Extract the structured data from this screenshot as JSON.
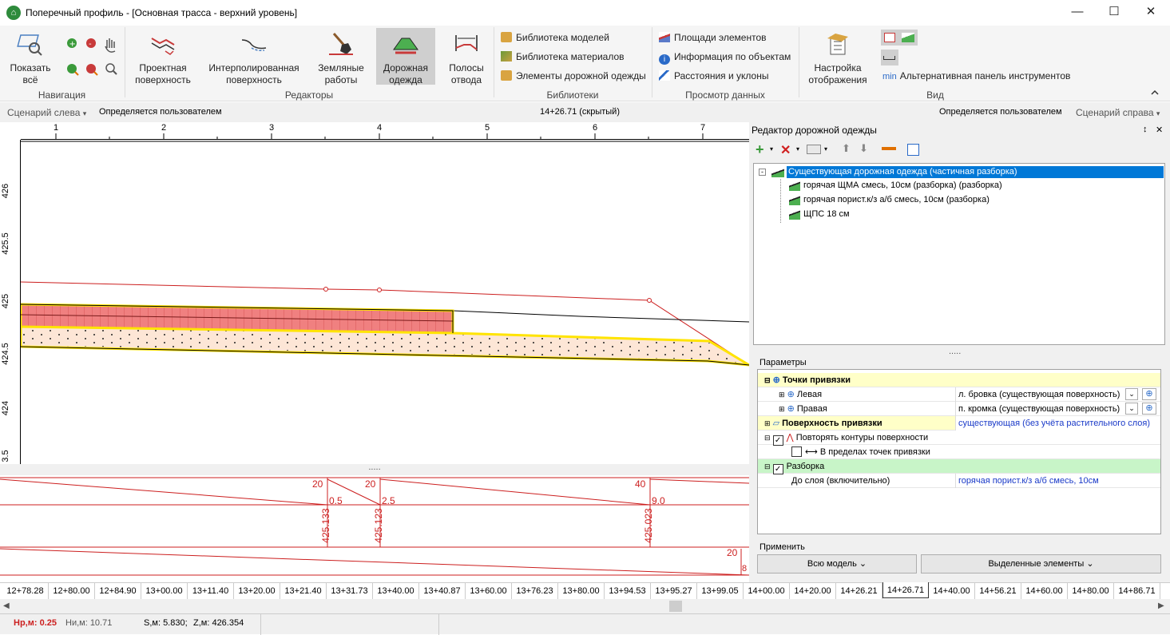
{
  "window": {
    "title": "Поперечный профиль - [Основная трасса - верхний уровень]",
    "app_icon_glyph": "⌂",
    "minimize": "—",
    "maximize": "☐",
    "close": "✕"
  },
  "ribbon": {
    "show_all": "Показать всё",
    "nav_group": "Навигация",
    "design_surface": "Проектная поверхность",
    "interp_surface": "Интерполированная поверхность",
    "earthworks": "Земляные работы",
    "pavement": "Дорожная одежда",
    "row_lanes": "Полосы отвода",
    "editors_group": "Редакторы",
    "lib_models": "Библиотека моделей",
    "lib_materials": "Библиотека материалов",
    "pavement_elements": "Элементы дорожной одежды",
    "libraries_group": "Библиотеки",
    "element_areas": "Площади элементов",
    "object_info": "Информация по объектам",
    "distances_slopes": "Расстояния и уклоны",
    "data_view_group": "Просмотр данных",
    "display_settings": "Настройка отображения",
    "alt_panel_prefix": "min",
    "alt_panel": "Альтернативная панель инструментов",
    "view_group": "Вид"
  },
  "scenario": {
    "left_label": "Сценарий слева",
    "left_value": "Определяется пользователем",
    "station": "14+26.71 (скрытый)",
    "right_value": "Определяется пользователем",
    "right_label": "Сценарий справа"
  },
  "ruler": {
    "top": [
      "1",
      "2",
      "3",
      "4",
      "5",
      "6",
      "7"
    ],
    "left": [
      "426",
      "425.5",
      "425",
      "424.5",
      "424",
      "3.5"
    ]
  },
  "bottom_view": {
    "labels_top": [
      "20",
      "20",
      "40",
      "20"
    ],
    "labels_dist": [
      "0.5",
      "2.5",
      "9.0"
    ],
    "labels_elev": [
      "425.133",
      "425.123",
      "425.023"
    ],
    "edge_value": "8"
  },
  "stations": [
    "12+78.28",
    "12+80.00",
    "12+84.90",
    "13+00.00",
    "13+11.40",
    "13+20.00",
    "13+21.40",
    "13+31.73",
    "13+40.00",
    "13+40.87",
    "13+60.00",
    "13+76.23",
    "13+80.00",
    "13+94.53",
    "13+95.27",
    "13+99.05",
    "14+00.00",
    "14+20.00",
    "14+26.21",
    "14+26.71",
    "14+40.00",
    "14+56.21",
    "14+60.00",
    "14+80.00",
    "14+86.71"
  ],
  "active_station": "14+26.71",
  "status": {
    "np": "Нр,м: 0.25",
    "ni": "Ни,м: 10.71",
    "s": "S,м: 5.830;",
    "z": "Z,м: 426.354"
  },
  "pavement_editor": {
    "title": "Редактор дорожной одежды",
    "pin": "↕",
    "close": "✕",
    "root": "Существующая дорожная одежда (частичная разборка)",
    "layers": [
      "горячая ЩМА смесь, 10см (разборка) (разборка)",
      "горячая порист.к/з а/б смесь, 10см (разборка)",
      "ЩПС 18 см"
    ]
  },
  "params": {
    "header": "Параметры",
    "anchor_points": "Точки привязки",
    "left": "Левая",
    "left_value": "л. бровка (существующая поверхность)",
    "right": "Правая",
    "right_value": "п. кромка (существующая поверхность)",
    "anchor_surface": "Поверхность привязки",
    "anchor_surface_value": "существующая (без учёта растительного слоя)",
    "repeat_contours": "Повторять контуры поверхности",
    "within_points": "В пределах точек привязки",
    "dismantle": "Разборка",
    "to_layer": "До слоя (включительно)",
    "to_layer_value": "горячая порист.к/з а/б смесь, 10см"
  },
  "apply": {
    "label": "Применить",
    "whole_model": "Всю модель",
    "selected": "Выделенные элементы"
  },
  "colors": {
    "accent_red": "#cc1f1f",
    "selection_blue": "#0078d7",
    "yellow_row": "#ffffc8",
    "green_row": "#c8f5c8",
    "layer_pink": "#f08080",
    "layer_cream": "#fde6d6"
  }
}
